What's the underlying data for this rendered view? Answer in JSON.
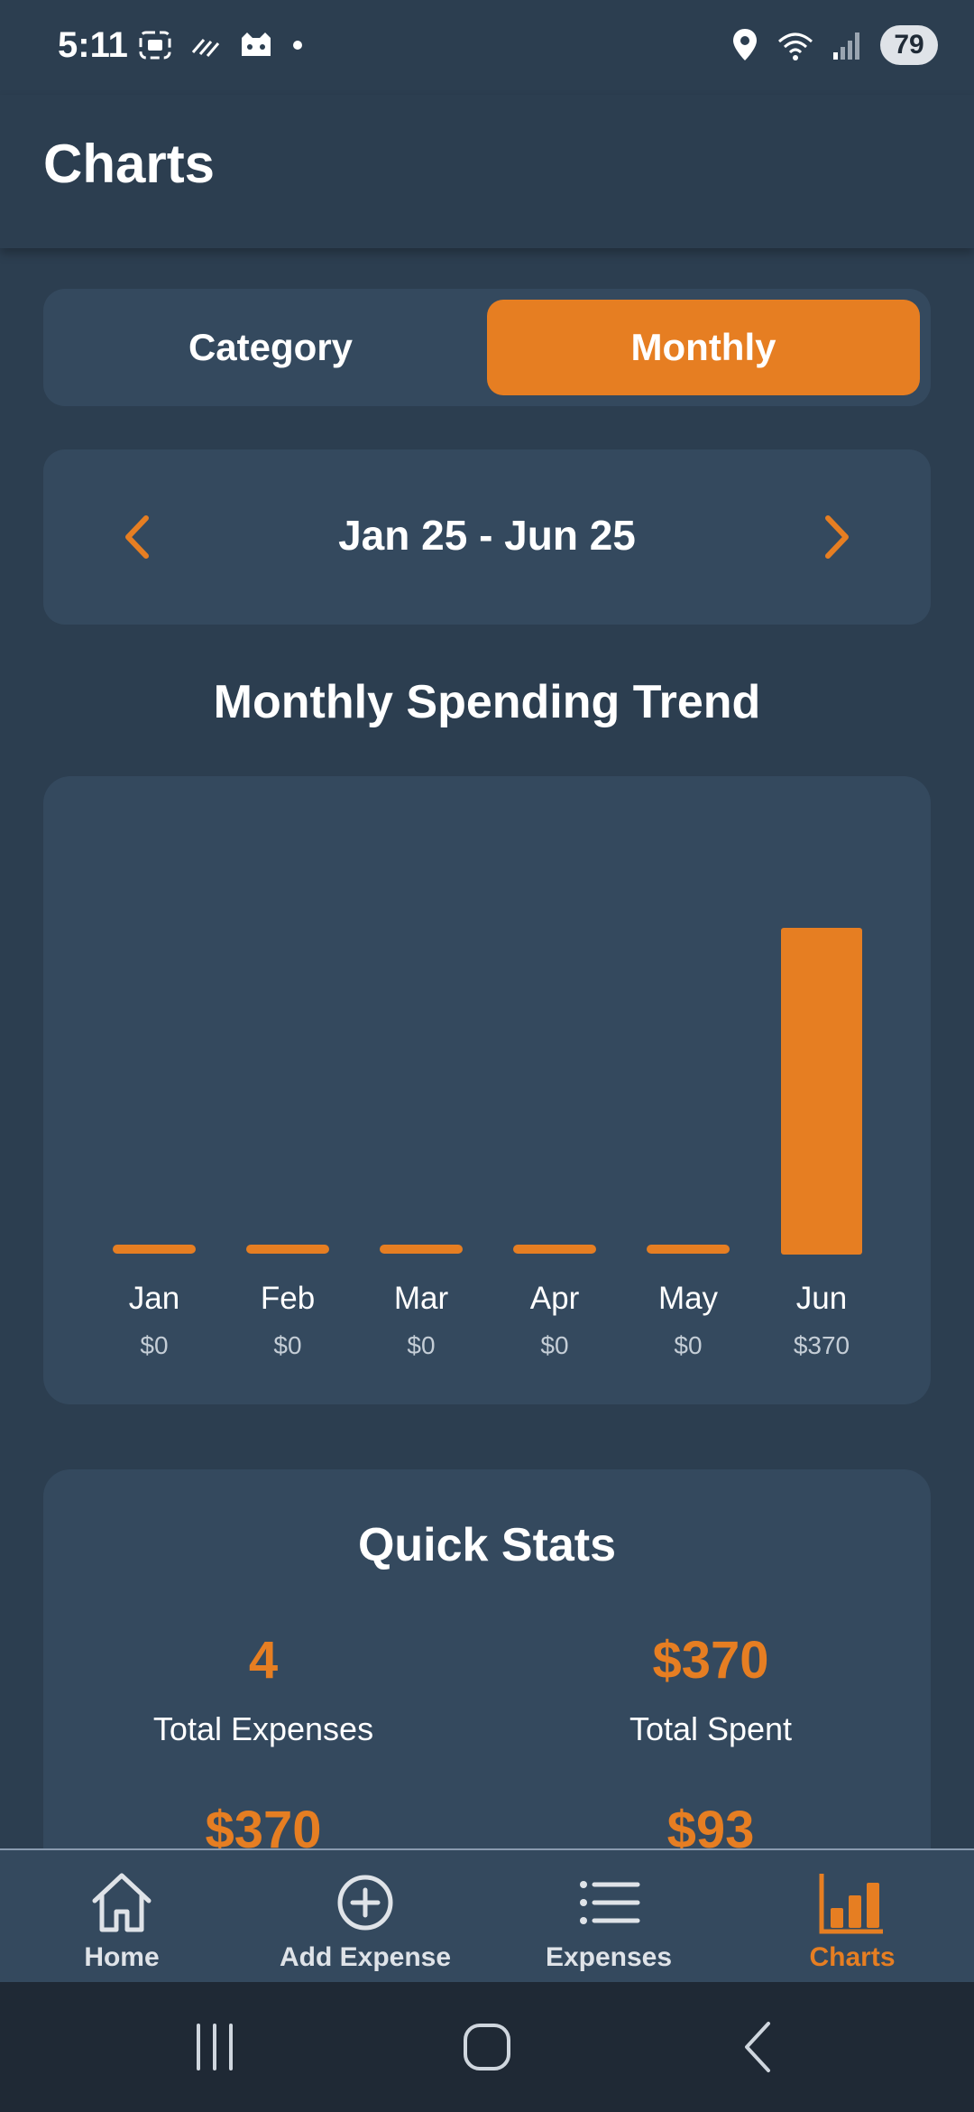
{
  "status_bar": {
    "time": "5:11",
    "battery": "79"
  },
  "header": {
    "title": "Charts"
  },
  "toggle": {
    "options": [
      "Category",
      "Monthly"
    ],
    "selected": "Monthly"
  },
  "date_range": {
    "label": "Jan 25 - Jun 25"
  },
  "chart_section": {
    "title": "Monthly Spending Trend"
  },
  "chart_data": {
    "type": "bar",
    "title": "Monthly Spending Trend",
    "categories": [
      "Jan",
      "Feb",
      "Mar",
      "Apr",
      "May",
      "Jun"
    ],
    "values": [
      0,
      0,
      0,
      0,
      0,
      370
    ],
    "value_labels": [
      "$0",
      "$0",
      "$0",
      "$0",
      "$0",
      "$370"
    ],
    "color": "#e67e22",
    "grid": false
  },
  "quick_stats": {
    "title": "Quick Stats",
    "items": [
      {
        "value": "4",
        "label": "Total Expenses"
      },
      {
        "value": "$370",
        "label": "Total Spent"
      },
      {
        "value": "$370",
        "label": ""
      },
      {
        "value": "$93",
        "label": ""
      }
    ]
  },
  "bottom_nav": {
    "items": [
      {
        "label": "Home",
        "icon": "home-icon"
      },
      {
        "label": "Add Expense",
        "icon": "add-circle-icon"
      },
      {
        "label": "Expenses",
        "icon": "list-icon"
      },
      {
        "label": "Charts",
        "icon": "bar-chart-icon"
      }
    ],
    "active": "Charts"
  },
  "colors": {
    "background": "#2c3e50",
    "card": "#34495e",
    "accent": "#e67e22",
    "text": "#ffffff"
  }
}
